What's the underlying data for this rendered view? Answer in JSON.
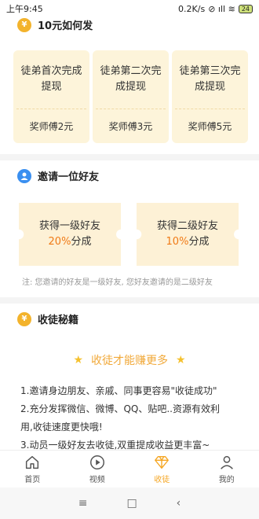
{
  "status_bar": {
    "time": "上午9:45",
    "speed": "0.2K/s",
    "icons": "⊘ ıll ≋",
    "battery": "24"
  },
  "section1": {
    "icon": "coin-icon",
    "title": "10元如何发"
  },
  "rewards": [
    {
      "title": "徒弟首次完成提现",
      "reward": "奖师傅2元"
    },
    {
      "title": "徒弟第二次完成提现",
      "reward": "奖师傅3元"
    },
    {
      "title": "徒弟第三次完成提现",
      "reward": "奖师傅5元"
    }
  ],
  "section2": {
    "icon": "user-icon",
    "title": "邀请一位好友"
  },
  "invites": [
    {
      "line1": "获得一级好友",
      "percent": "20%",
      "suffix": "分成"
    },
    {
      "line1": "获得二级好友",
      "percent": "10%",
      "suffix": "分成"
    }
  ],
  "note": "注:   您邀请的好友是一级好友,    您好友邀请的是二级好友",
  "section3": {
    "icon": "coin-icon",
    "title": "收徒秘籍"
  },
  "secret": {
    "title": "收徒才能赚更多",
    "lines": [
      "1.邀请身边朋友、亲戚、同事更容易\"收徒成功\"",
      "2.充分发挥微信、微博、QQ、贴吧..资源有效利",
      "用,收徒速度更快哦!",
      "3.动员一级好友去收徒,双重提成收益更丰富~"
    ]
  },
  "nav": [
    {
      "label": "首页",
      "icon": "home-icon",
      "active": false
    },
    {
      "label": "视频",
      "icon": "play-icon",
      "active": false
    },
    {
      "label": "收徒",
      "icon": "diamond-icon",
      "active": true
    },
    {
      "label": "我的",
      "icon": "profile-icon",
      "active": false
    }
  ],
  "sys_nav": {
    "menu": "≡",
    "home": "□",
    "back": "‹"
  },
  "colors": {
    "accent": "#f5a623",
    "card_bg": "#fdf4da",
    "highlight": "#f07a16"
  }
}
